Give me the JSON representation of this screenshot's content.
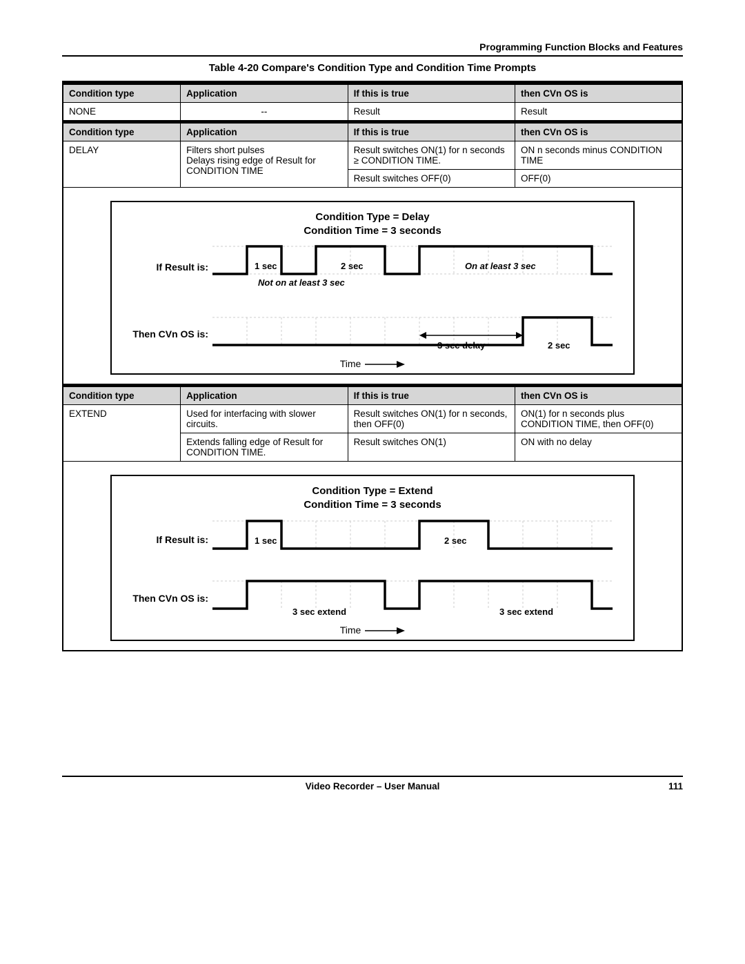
{
  "header": {
    "section_title": "Programming Function Blocks and Features"
  },
  "table": {
    "caption": "Table 4-20   Compare's Condition Type and Condition Time Prompts",
    "headers": {
      "col1": "Condition type",
      "col2": "Application",
      "col3": "If this is true",
      "col4": "then CVn OS is"
    },
    "none_row": {
      "type": "NONE",
      "application": "--",
      "if_true": "Result",
      "then": "Result"
    },
    "delay_row1": {
      "type": "DELAY",
      "application": "Filters short pulses\nDelays rising edge of Result for CONDITION TIME",
      "if_true": "Result switches ON(1) for n seconds ≥ CONDITION TIME.",
      "then": "ON n seconds minus CONDITION TIME"
    },
    "delay_row2": {
      "if_true": "Result switches OFF(0)",
      "then": "OFF(0)"
    },
    "extend_row1": {
      "type": "EXTEND",
      "application": "Used for interfacing with slower circuits.",
      "if_true": "Result switches ON(1) for n seconds, then OFF(0)",
      "then": "ON(1) for n seconds plus CONDITION TIME, then OFF(0)"
    },
    "extend_row2": {
      "application": "Extends falling edge of Result for CONDITION TIME.",
      "if_true": "Result switches ON(1)",
      "then": "ON with no delay"
    }
  },
  "diagram_delay": {
    "title_line1": "Condition Type = Delay",
    "title_line2": "Condition Time = 3 seconds",
    "label_result": "If Result is:",
    "label_cvn": "Then CVn OS is:",
    "ann_1sec": "1 sec",
    "ann_2sec_top": "2 sec",
    "ann_on_at_least": "On at least 3 sec",
    "ann_not_on": "Not on at least 3 sec",
    "ann_3sec_delay": "3 sec delay",
    "ann_2sec_bottom": "2 sec",
    "time_label": "Time"
  },
  "diagram_extend": {
    "title_line1": "Condition Type = Extend",
    "title_line2": "Condition Time = 3 seconds",
    "label_result": "If Result is:",
    "label_cvn": "Then CVn OS is:",
    "ann_1sec": "1 sec",
    "ann_2sec": "2 sec",
    "ann_3sec_extend_1": "3 sec extend",
    "ann_3sec_extend_2": "3 sec extend",
    "time_label": "Time"
  },
  "footer": {
    "doc_title": "Video Recorder – User Manual",
    "page": "111"
  }
}
